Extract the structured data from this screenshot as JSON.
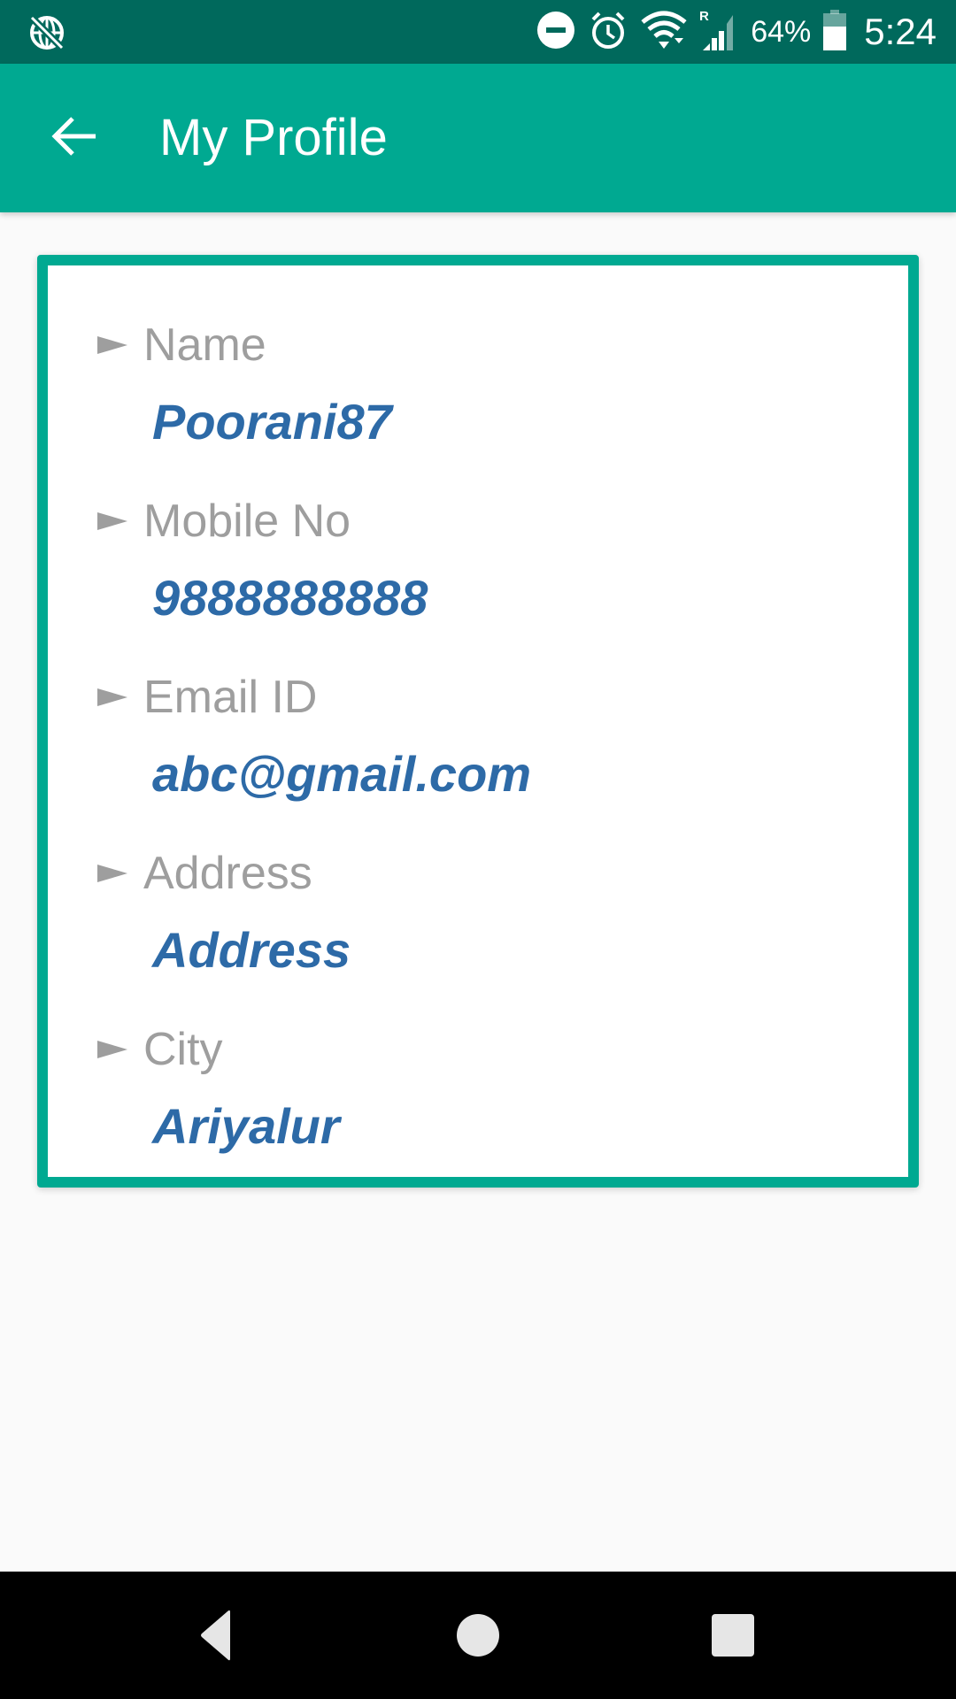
{
  "status_bar": {
    "left_icon": "data-saver-globe-off-icon",
    "icons": [
      "do-not-disturb-icon",
      "alarm-icon",
      "wifi-icon",
      "signal-roaming-icon",
      "battery-icon"
    ],
    "roaming_label": "R",
    "battery": "64%",
    "battery_level": 0.64,
    "time": "5:24"
  },
  "app_bar": {
    "back_icon": "arrow-back-icon",
    "title": "My Profile"
  },
  "profile": {
    "fields": [
      {
        "label": "Name",
        "value": "Poorani87"
      },
      {
        "label": "Mobile No",
        "value": "9888888888"
      },
      {
        "label": "Email ID",
        "value": "abc@gmail.com"
      },
      {
        "label": "Address",
        "value": "Address"
      },
      {
        "label": "City",
        "value": "Ariyalur"
      }
    ]
  },
  "nav_bar": {
    "back": "nav-back-icon",
    "home": "nav-home-icon",
    "recents": "nav-recents-icon"
  },
  "colors": {
    "status_bar": "#00695c",
    "primary": "#00a991",
    "label": "#9e9e9e",
    "value": "#2d6aa7",
    "background": "#fafafa"
  }
}
